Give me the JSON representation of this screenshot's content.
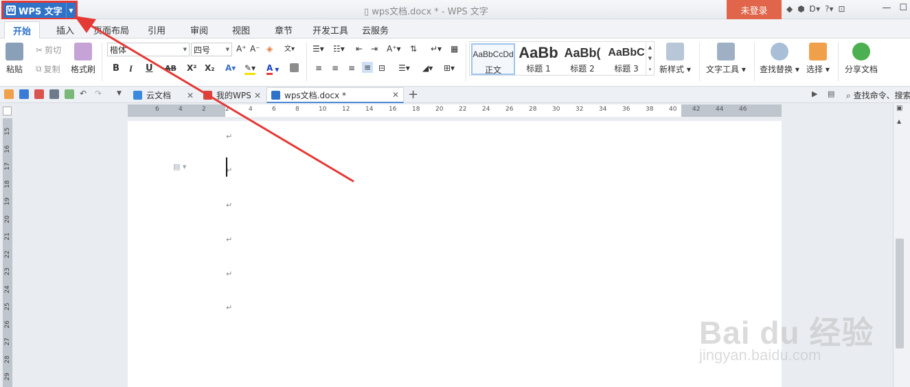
{
  "titlebar": {
    "app_menu_label": "WPS 文字",
    "doc_title": "wps文档.docx * - WPS 文字",
    "login_label": "未登录"
  },
  "menu_tabs": [
    "开始",
    "插入",
    "页面布局",
    "引用",
    "审阅",
    "视图",
    "章节",
    "开发工具",
    "云服务"
  ],
  "ribbon": {
    "paste": "粘贴",
    "cut": "剪切",
    "copy": "复制",
    "format_painter": "格式刷",
    "font_name": "楷体",
    "font_size": "四号",
    "bold": "B",
    "italic": "I",
    "underline": "U",
    "strike": "AB",
    "superscript": "X²",
    "subscript": "X₂",
    "styles": [
      {
        "sample": "AaBbCcDd",
        "label": "正文"
      },
      {
        "sample": "AaBb",
        "label": "标题 1"
      },
      {
        "sample": "AaBb(",
        "label": "标题 2"
      },
      {
        "sample": "AaBbC",
        "label": "标题 3"
      }
    ],
    "new_style": "新样式",
    "text_tools": "文字工具",
    "find_replace": "查找替换",
    "select": "选择",
    "share": "分享文档"
  },
  "tabs": {
    "cloud": "云文档",
    "my_wps": "我的WPS",
    "current_doc": "wps文档.docx *"
  },
  "search_cmd": "查找命令、搜索",
  "ruler": {
    "h_numbers": [
      "6",
      "4",
      "2",
      "2",
      "4",
      "6",
      "8",
      "10",
      "12",
      "14",
      "16",
      "18",
      "20",
      "22",
      "24",
      "26",
      "28",
      "30",
      "32",
      "34",
      "36",
      "38",
      "40",
      "42",
      "44",
      "46"
    ],
    "v_numbers": [
      "15",
      "16",
      "17",
      "18",
      "19",
      "20",
      "21",
      "22",
      "23",
      "24",
      "25",
      "26",
      "27",
      "28",
      "29"
    ]
  },
  "page": {
    "para_mark": "↵"
  },
  "watermark": {
    "main": "Bai du 经验",
    "sub": "jingyan.baidu.com"
  },
  "colors": {
    "app_blue": "#2f73c9",
    "login_red": "#e0654a",
    "annotation_red": "#e53935"
  }
}
